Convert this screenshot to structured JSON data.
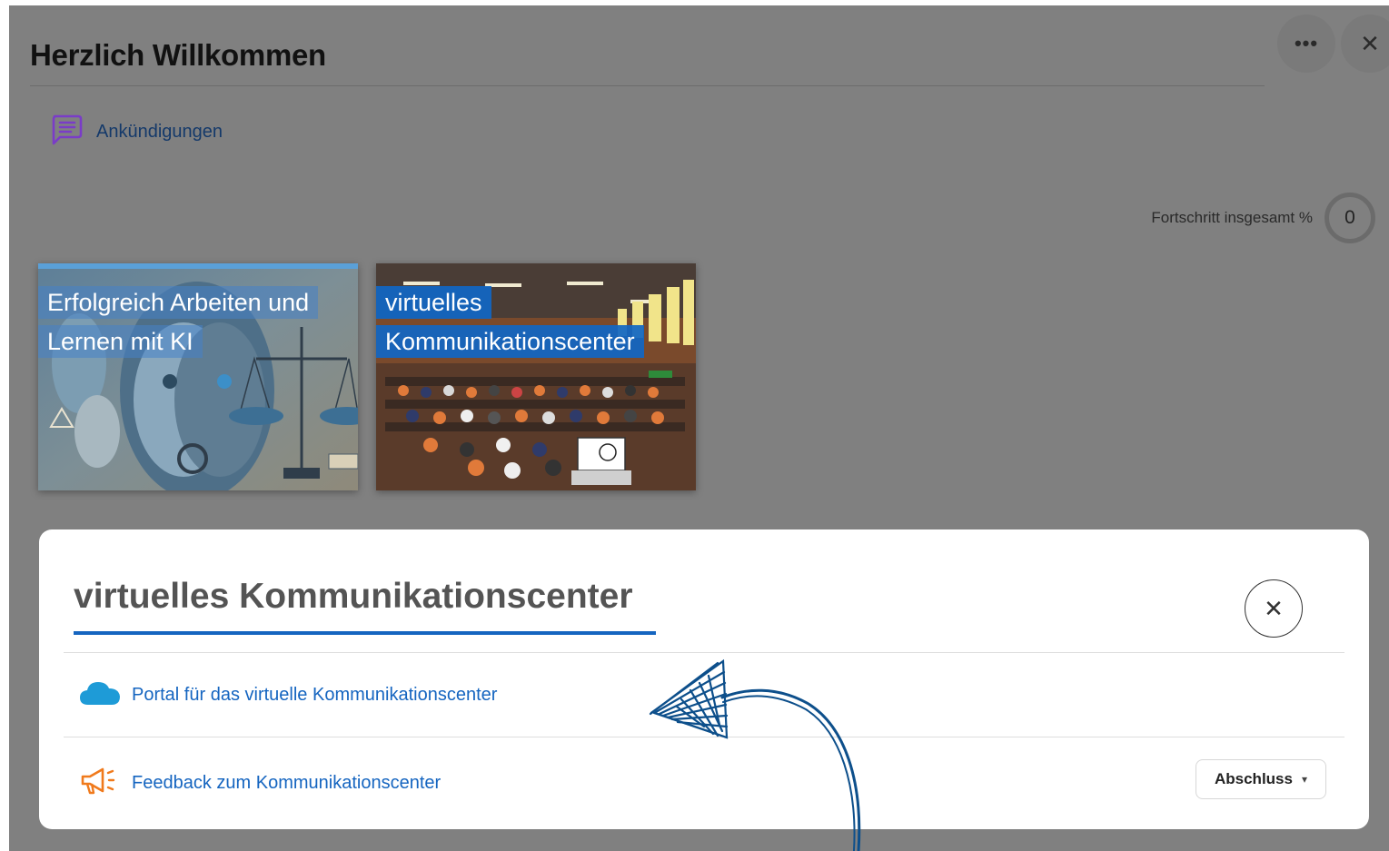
{
  "header": {
    "title": "Herzlich Willkommen",
    "more_label": "•••",
    "close_label": "✕"
  },
  "announcements": {
    "label": "Ankündigungen",
    "icon": "chat-lines-icon"
  },
  "progress": {
    "label": "Fortschritt insgesamt %",
    "value": "0"
  },
  "tiles": [
    {
      "title": "Erfolgreich Arbeiten und Lernen mit KI",
      "lines": [
        "Erfolgreich Arbeiten und",
        "Lernen mit KI"
      ]
    },
    {
      "title": "virtuelles Kommunikationscenter",
      "lines": [
        "virtuelles",
        "Kommunikationscenter"
      ]
    }
  ],
  "modal": {
    "title": "virtuelles Kommunikationscenter",
    "close_label": "✕",
    "activities": [
      {
        "label": "Portal für das virtuelle Kommunikationscenter",
        "icon": "cloud-icon",
        "color": "#1e9bd7"
      },
      {
        "label": "Feedback zum Kommunikationscenter",
        "icon": "megaphone-icon",
        "color": "#f07a1c",
        "completion_label": "Abschluss"
      }
    ]
  },
  "colors": {
    "accent": "#1565c0",
    "backdrop": "#808080",
    "annotation": "#0d4f8b"
  }
}
